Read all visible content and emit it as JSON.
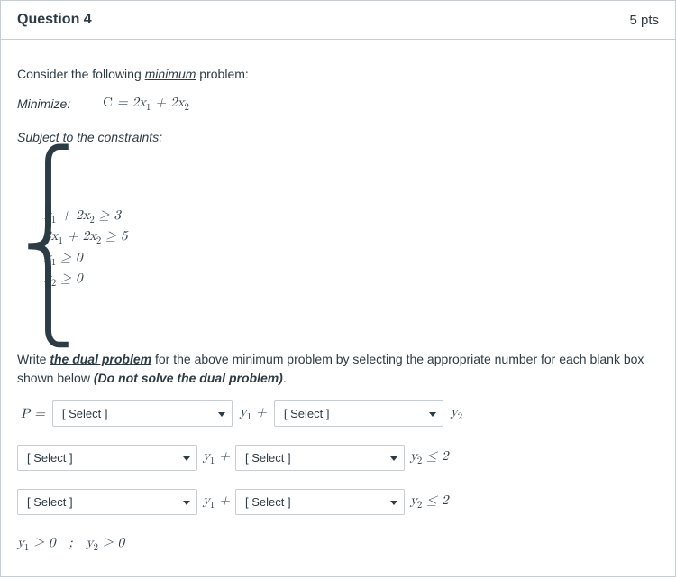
{
  "header": {
    "title": "Question 4",
    "points": "5 pts"
  },
  "body": {
    "intro": "Consider the following ",
    "intro_underline": "minimum",
    "intro_end": " problem:",
    "minimize_label": "Minimize:",
    "objective": "C = 2x₁ + 2x₂",
    "subject_label": "Subject to the constraints:",
    "constraints": [
      "x₁ + 2x₂ ≥ 3",
      "3x₁ + 2x₂ ≥ 5",
      "x₁ ≥ 0",
      "x₂ ≥ 0"
    ],
    "instr_pre": "Write ",
    "instr_bold": "the dual problem",
    "instr_mid": " for the above minimum problem by selecting the appropriate number for each blank box shown below ",
    "instr_bold2": "(Do not solve the dual problem)",
    "instr_end": ".",
    "p_equals": "P =",
    "select_placeholder": "[ Select ]",
    "y1plus": "y₁ +",
    "y2": "y₂",
    "y2_le_2": "y₂ ≤ 2",
    "final_nonneg": "y₁ ≥ 0    ;    y₂ ≥ 0"
  }
}
